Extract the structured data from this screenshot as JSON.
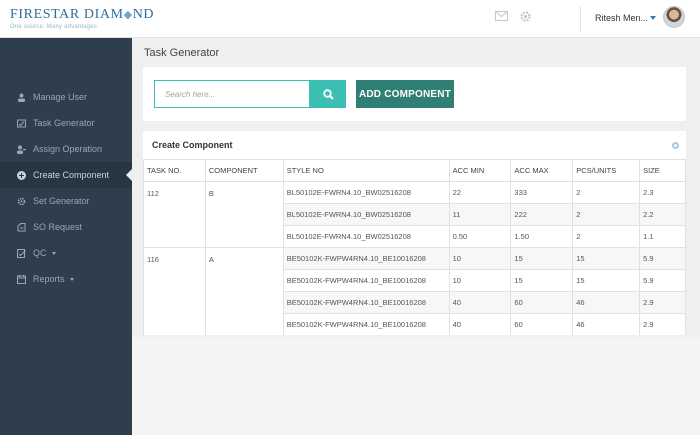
{
  "brand": {
    "name_part1": "FIRESTAR DIAM",
    "name_part2": "ND",
    "gem_glyph": "◆",
    "tagline": "One source. Many advantages"
  },
  "header": {
    "user_name": "Ritesh Men...",
    "icons": [
      "mail-icon",
      "gear-icon"
    ]
  },
  "sidebar": {
    "items": [
      {
        "label": "Manage User",
        "icon": "user-icon",
        "active": false,
        "has_caret": false
      },
      {
        "label": "Task Generator",
        "icon": "task-icon",
        "active": false,
        "has_caret": false
      },
      {
        "label": "Assign Operation",
        "icon": "assign-icon",
        "active": false,
        "has_caret": false
      },
      {
        "label": "Create Component",
        "icon": "plus-circle-icon",
        "active": true,
        "has_caret": false
      },
      {
        "label": "Set Generator",
        "icon": "gear-icon",
        "active": false,
        "has_caret": false
      },
      {
        "label": "SO Request",
        "icon": "request-icon",
        "active": false,
        "has_caret": false
      },
      {
        "label": "QC",
        "icon": "qc-icon",
        "active": false,
        "has_caret": true
      },
      {
        "label": "Reports",
        "icon": "reports-icon",
        "active": false,
        "has_caret": true
      }
    ]
  },
  "main": {
    "page_title": "Task Generator",
    "search": {
      "placeholder": "Search here..."
    },
    "add_component_label": "ADD COMPONENT",
    "table_title": "Create Component",
    "columns": [
      "TASK NO.",
      "COMPONENT",
      "STYLE NO",
      "ACC MIN",
      "ACC MAX",
      "PCS/UNITS",
      "SIZE"
    ],
    "groups": [
      {
        "task_no": "112",
        "component": "B",
        "rows": [
          {
            "style_no": "BL50102E-FWRN4.10_BW02516208",
            "acc_min": "22",
            "acc_max": "333",
            "pcs": "2",
            "size": "2.3"
          },
          {
            "style_no": "BL50102E-FWRN4.10_BW02516208",
            "acc_min": "11",
            "acc_max": "222",
            "pcs": "2",
            "size": "2.2"
          },
          {
            "style_no": "BL50102E-FWRN4.10_BW02516208",
            "acc_min": "0.50",
            "acc_max": "1.50",
            "pcs": "2",
            "size": "1.1"
          }
        ]
      },
      {
        "task_no": "116",
        "component": "A",
        "rows": [
          {
            "style_no": "BE50102K-FWPW4RN4.10_BE10016208",
            "acc_min": "10",
            "acc_max": "15",
            "pcs": "15",
            "size": "5.9"
          },
          {
            "style_no": "BE50102K-FWPW4RN4.10_BE10016208",
            "acc_min": "10",
            "acc_max": "15",
            "pcs": "15",
            "size": "5.9"
          },
          {
            "style_no": "BE50102K-FWPW4RN4.10_BE10016208",
            "acc_min": "40",
            "acc_max": "60",
            "pcs": "46",
            "size": "2.9"
          },
          {
            "style_no": "BE50102K-FWPW4RN4.10_BE10016208",
            "acc_min": "40",
            "acc_max": "60",
            "pcs": "46",
            "size": "2.9"
          }
        ]
      }
    ]
  },
  "colors": {
    "sidebar_bg": "#2f3e4c",
    "teal_accent": "#3cbfb3",
    "add_button_bg": "#2f7f75",
    "user_caret": "#2a7fbf"
  }
}
